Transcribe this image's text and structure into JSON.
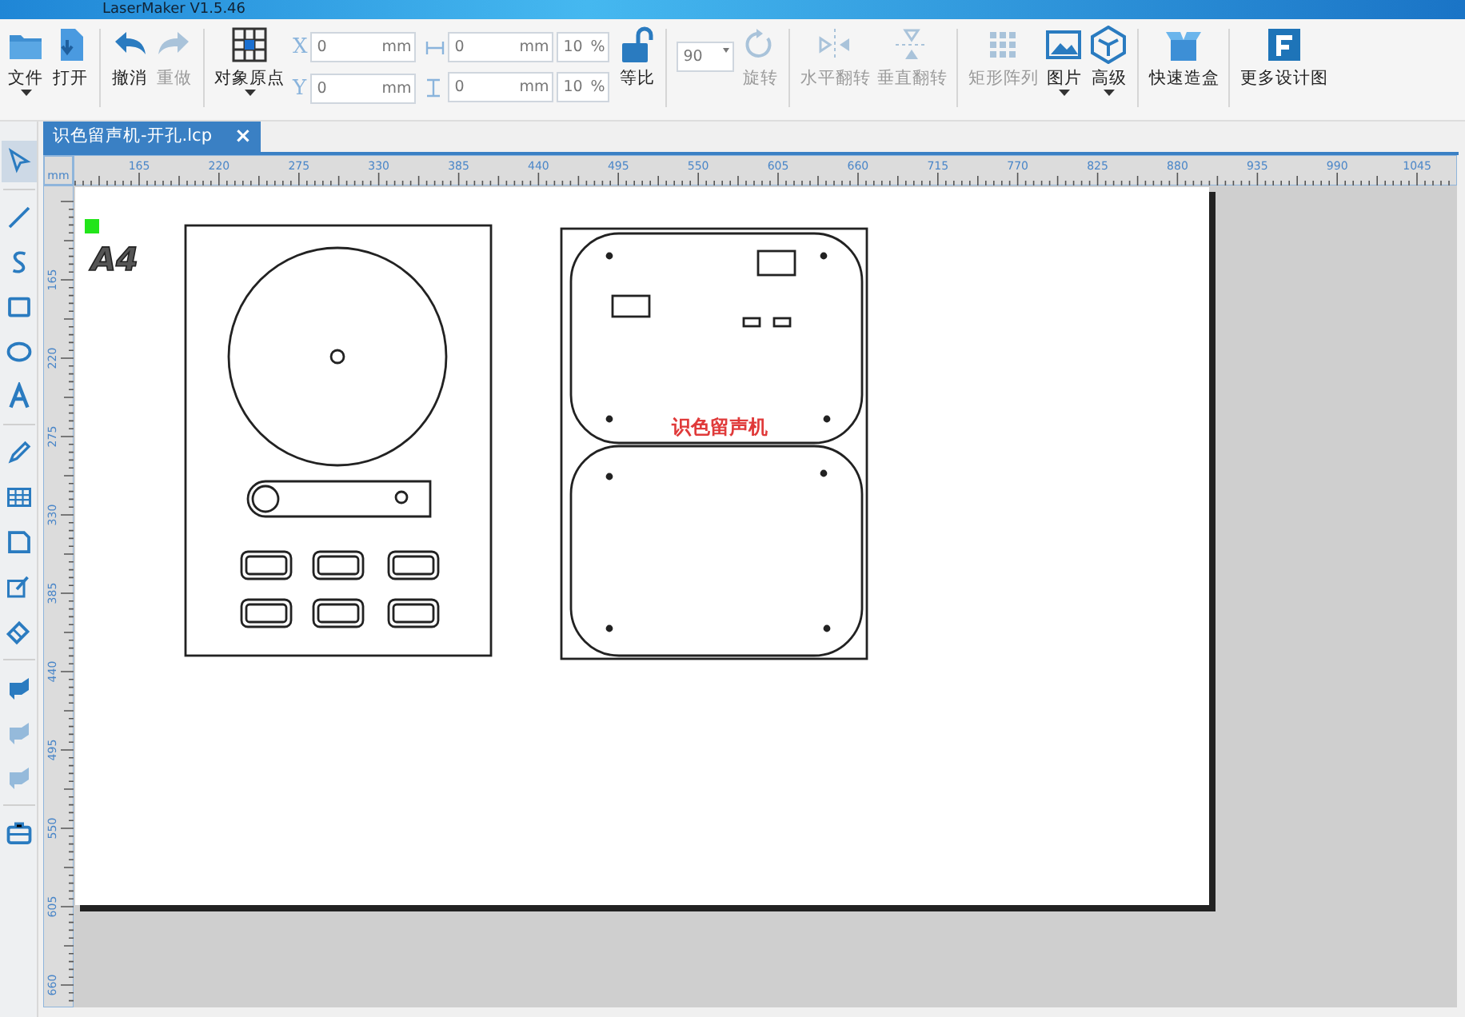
{
  "window": {
    "title": "LaserMaker V1.5.46"
  },
  "toolbar": [
    {
      "kind": "file",
      "label": "文件",
      "disabled": false,
      "dropdown": true
    },
    {
      "kind": "open",
      "label": "打开",
      "disabled": false,
      "dropdown": false
    },
    {
      "kind": "separator"
    },
    {
      "kind": "undo",
      "label": "撤消",
      "disabled": false,
      "dropdown": false
    },
    {
      "kind": "redo",
      "label": "重做",
      "disabled": true,
      "dropdown": false
    },
    {
      "kind": "separator"
    },
    {
      "kind": "origin",
      "label": "对象原点",
      "disabled": false,
      "dropdown": true
    },
    {
      "kind": "position",
      "rows": [
        {
          "axis": "X",
          "value": "0",
          "unit": "mm"
        },
        {
          "axis": "Y",
          "value": "0",
          "unit": "mm"
        }
      ]
    },
    {
      "kind": "size",
      "rows": [
        {
          "value": "0",
          "unit": "mm",
          "scale": "10",
          "scale_unit": "%"
        },
        {
          "value": "0",
          "unit": "mm",
          "scale": "10",
          "scale_unit": "%"
        }
      ]
    },
    {
      "kind": "lock",
      "label": "等比",
      "disabled": false,
      "dropdown": false
    },
    {
      "kind": "separator"
    },
    {
      "kind": "angle",
      "value": "90"
    },
    {
      "kind": "rotate",
      "label": "旋转",
      "disabled": true,
      "dropdown": false
    },
    {
      "kind": "separator"
    },
    {
      "kind": "hflip",
      "label": "水平翻转",
      "disabled": true,
      "dropdown": false
    },
    {
      "kind": "vflip",
      "label": "垂直翻转",
      "disabled": true,
      "dropdown": false
    },
    {
      "kind": "separator"
    },
    {
      "kind": "array",
      "label": "矩形阵列",
      "disabled": true,
      "dropdown": false
    },
    {
      "kind": "image",
      "label": "图片",
      "disabled": false,
      "dropdown": true
    },
    {
      "kind": "cube",
      "label": "高级",
      "disabled": false,
      "dropdown": true
    },
    {
      "kind": "separator"
    },
    {
      "kind": "box",
      "label": "快速造盒",
      "disabled": false,
      "dropdown": false
    },
    {
      "kind": "separator"
    },
    {
      "kind": "more",
      "label": "更多设计图",
      "disabled": false,
      "dropdown": false
    }
  ],
  "tools": [
    {
      "kind": "pointer",
      "selected": true,
      "disabled": false
    },
    {
      "kind": "separator"
    },
    {
      "kind": "line",
      "selected": false,
      "disabled": false
    },
    {
      "kind": "curve",
      "selected": false,
      "disabled": false
    },
    {
      "kind": "rectangle",
      "selected": false,
      "disabled": false
    },
    {
      "kind": "ellipse",
      "selected": false,
      "disabled": false
    },
    {
      "kind": "text",
      "selected": false,
      "disabled": false
    },
    {
      "kind": "separator"
    },
    {
      "kind": "pen",
      "selected": false,
      "disabled": false
    },
    {
      "kind": "table",
      "selected": false,
      "disabled": false
    },
    {
      "kind": "frame",
      "selected": false,
      "disabled": false
    },
    {
      "kind": "edit",
      "selected": false,
      "disabled": false
    },
    {
      "kind": "eraser",
      "selected": false,
      "disabled": false
    },
    {
      "kind": "separator"
    },
    {
      "kind": "fill",
      "selected": false,
      "disabled": false
    },
    {
      "kind": "fill",
      "selected": false,
      "disabled": true
    },
    {
      "kind": "fill",
      "selected": false,
      "disabled": true
    },
    {
      "kind": "separator"
    },
    {
      "kind": "toolbox",
      "selected": false,
      "disabled": false
    }
  ],
  "tabs": [
    {
      "label": "识色留声机-开孔.lcp",
      "selected": true,
      "close": "×"
    }
  ],
  "ruler": {
    "unit": "mm",
    "x_labels": [
      "165",
      "220",
      "275",
      "330",
      "385",
      "440",
      "495",
      "550",
      "605",
      "660",
      "715",
      "770",
      "825",
      "880",
      "935",
      "990",
      "1045"
    ],
    "y_labels": [
      "165",
      "220",
      "275",
      "330",
      "385",
      "440",
      "495",
      "550",
      "605",
      "660"
    ]
  },
  "canvas": {
    "page_label": "A4",
    "engraving_text": "识色留声机"
  }
}
